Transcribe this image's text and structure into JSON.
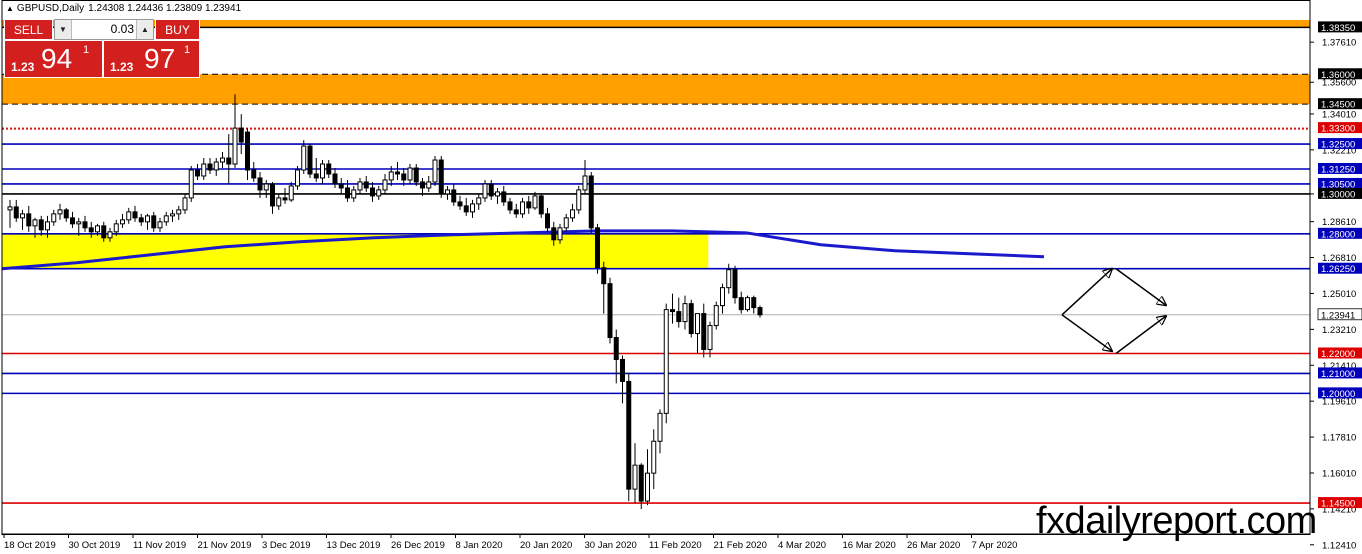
{
  "header": {
    "symbol": "GBPUSD,Daily",
    "ohlc": "1.24308 1.24436 1.23809 1.23941"
  },
  "trade_panel": {
    "sell_label": "SELL",
    "buy_label": "BUY",
    "lot_value": "0.03",
    "sell_price": {
      "prefix": "1.23",
      "big": "94",
      "pip": "1"
    },
    "buy_price": {
      "prefix": "1.23",
      "big": "97",
      "pip": "1"
    }
  },
  "watermark": "fxdailyreport.com",
  "colors": {
    "bull": "#ffffff",
    "bear": "#000000",
    "ma": "#1a1acc",
    "zone_orange": "#ffa000",
    "zone_yellow": "#ffff00",
    "support_red": "#dd0000",
    "level_blue": "#0000bb",
    "level_black": "#000000",
    "panel_red": "#d41f1f"
  },
  "chart_data": {
    "type": "candlestick",
    "symbol": "GBPUSD",
    "timeframe": "Daily",
    "ylim": [
      1.1295,
      1.3872
    ],
    "yticks": [
      "1.37610",
      "1.35600",
      "1.34010",
      "1.32210",
      "1.30000",
      "1.28610",
      "1.26810",
      "1.25010",
      "1.23210",
      "1.21410",
      "1.19610",
      "1.17810",
      "1.16010",
      "1.14210",
      "1.12410"
    ],
    "xticks": [
      "18 Oct 2019",
      "30 Oct 2019",
      "11 Nov 2019",
      "21 Nov 2019",
      "3 Dec 2019",
      "13 Dec 2019",
      "26 Dec 2019",
      "8 Jan 2020",
      "20 Jan 2020",
      "30 Jan 2020",
      "11 Feb 2020",
      "21 Feb 2020",
      "4 Mar 2020",
      "16 Mar 2020",
      "26 Mar 2020",
      "7 Apr 2020"
    ],
    "current_price": "1.23941",
    "levels": [
      {
        "price": 1.3835,
        "label": "1.38350",
        "color": "#000000",
        "style": "solid"
      },
      {
        "price": 1.36,
        "label": "1.36000",
        "color": "#000000",
        "style": "dashed"
      },
      {
        "price": 1.345,
        "label": "1.34500",
        "color": "#000000",
        "style": "dashed"
      },
      {
        "price": 1.333,
        "label": "1.33300",
        "color": "#dd0000",
        "style": "dotted"
      },
      {
        "price": 1.3325,
        "label": "",
        "color": "#dd0000",
        "style": "dotted"
      },
      {
        "price": 1.325,
        "label": "1.32500",
        "color": "#0000bb",
        "style": "solid"
      },
      {
        "price": 1.3125,
        "label": "1.31250",
        "color": "#0000bb",
        "style": "solid"
      },
      {
        "price": 1.305,
        "label": "1.30500",
        "color": "#0000bb",
        "style": "solid"
      },
      {
        "price": 1.3,
        "label": "1.30000",
        "color": "#000000",
        "style": "solid"
      },
      {
        "price": 1.28,
        "label": "1.28000",
        "color": "#0000bb",
        "style": "solid"
      },
      {
        "price": 1.2625,
        "label": "1.26250",
        "color": "#0000bb",
        "style": "solid"
      },
      {
        "price": 1.22,
        "label": "1.22000",
        "color": "#dd0000",
        "style": "solid"
      },
      {
        "price": 1.21,
        "label": "1.21000",
        "color": "#0000bb",
        "style": "solid"
      },
      {
        "price": 1.2,
        "label": "1.20000",
        "color": "#0000bb",
        "style": "solid"
      },
      {
        "price": 1.145,
        "label": "1.14500",
        "color": "#dd0000",
        "style": "solid"
      }
    ],
    "zones": [
      {
        "color": "#ffa000",
        "from": 1.3835,
        "to": 1.3872,
        "x_start": 0,
        "x_end": 1
      },
      {
        "color": "#ffa000",
        "from": 1.345,
        "to": 1.36,
        "x_start": 0,
        "x_end": 1
      },
      {
        "color": "#ffff00",
        "from": 1.2625,
        "to": 1.28,
        "x_start": 0,
        "x_end": 0.54
      }
    ],
    "moving_average": [
      1.2625,
      1.2655,
      1.2695,
      1.2735,
      1.276,
      1.278,
      1.2795,
      1.2805,
      1.2815,
      1.2815,
      1.2805,
      1.2745,
      1.2715,
      1.27,
      1.2685
    ],
    "ohlc": [
      [
        1.292,
        1.297,
        1.283,
        1.2935
      ],
      [
        1.2935,
        1.297,
        1.286,
        1.288
      ],
      [
        1.288,
        1.292,
        1.282,
        1.29
      ],
      [
        1.29,
        1.294,
        1.281,
        1.284
      ],
      [
        1.284,
        1.288,
        1.278,
        1.287
      ],
      [
        1.287,
        1.289,
        1.279,
        1.282
      ],
      [
        1.282,
        1.289,
        1.278,
        1.286
      ],
      [
        1.286,
        1.292,
        1.284,
        1.29
      ],
      [
        1.29,
        1.295,
        1.287,
        1.292
      ],
      [
        1.292,
        1.293,
        1.286,
        1.288
      ],
      [
        1.288,
        1.291,
        1.283,
        1.285
      ],
      [
        1.285,
        1.288,
        1.279,
        1.286
      ],
      [
        1.286,
        1.289,
        1.281,
        1.283
      ],
      [
        1.283,
        1.286,
        1.278,
        1.281
      ],
      [
        1.281,
        1.285,
        1.279,
        1.284
      ],
      [
        1.284,
        1.286,
        1.276,
        1.278
      ],
      [
        1.278,
        1.283,
        1.276,
        1.281
      ],
      [
        1.281,
        1.287,
        1.279,
        1.285
      ],
      [
        1.285,
        1.29,
        1.283,
        1.287
      ],
      [
        1.287,
        1.293,
        1.285,
        1.291
      ],
      [
        1.291,
        1.294,
        1.286,
        1.288
      ],
      [
        1.288,
        1.29,
        1.284,
        1.286
      ],
      [
        1.286,
        1.29,
        1.282,
        1.289
      ],
      [
        1.289,
        1.291,
        1.281,
        1.283
      ],
      [
        1.283,
        1.288,
        1.281,
        1.286
      ],
      [
        1.286,
        1.291,
        1.284,
        1.289
      ],
      [
        1.289,
        1.292,
        1.286,
        1.29
      ],
      [
        1.29,
        1.294,
        1.287,
        1.292
      ],
      [
        1.292,
        1.3,
        1.29,
        1.298
      ],
      [
        1.298,
        1.314,
        1.296,
        1.312
      ],
      [
        1.312,
        1.315,
        1.307,
        1.309
      ],
      [
        1.309,
        1.318,
        1.307,
        1.315
      ],
      [
        1.315,
        1.318,
        1.31,
        1.312
      ],
      [
        1.312,
        1.318,
        1.309,
        1.316
      ],
      [
        1.316,
        1.321,
        1.313,
        1.318
      ],
      [
        1.318,
        1.33,
        1.305,
        1.315
      ],
      [
        1.315,
        1.35,
        1.313,
        1.333
      ],
      [
        1.333,
        1.34,
        1.32,
        1.326
      ],
      [
        1.331,
        1.333,
        1.307,
        1.312
      ],
      [
        1.312,
        1.316,
        1.306,
        1.308
      ],
      [
        1.308,
        1.311,
        1.298,
        1.302
      ],
      [
        1.302,
        1.307,
        1.298,
        1.305
      ],
      [
        1.305,
        1.306,
        1.29,
        1.294
      ],
      [
        1.294,
        1.3,
        1.292,
        1.298
      ],
      [
        1.298,
        1.303,
        1.295,
        1.297
      ],
      [
        1.297,
        1.306,
        1.296,
        1.304
      ],
      [
        1.304,
        1.314,
        1.302,
        1.312
      ],
      [
        1.312,
        1.327,
        1.31,
        1.324
      ],
      [
        1.324,
        1.325,
        1.308,
        1.31
      ],
      [
        1.31,
        1.318,
        1.306,
        1.308
      ],
      [
        1.308,
        1.317,
        1.305,
        1.315
      ],
      [
        1.315,
        1.317,
        1.308,
        1.31
      ],
      [
        1.31,
        1.313,
        1.303,
        1.305
      ],
      [
        1.305,
        1.308,
        1.3,
        1.303
      ],
      [
        1.303,
        1.307,
        1.296,
        1.298
      ],
      [
        1.298,
        1.304,
        1.296,
        1.302
      ],
      [
        1.302,
        1.308,
        1.3,
        1.306
      ],
      [
        1.306,
        1.309,
        1.301,
        1.303
      ],
      [
        1.303,
        1.306,
        1.296,
        1.299
      ],
      [
        1.299,
        1.304,
        1.297,
        1.302
      ],
      [
        1.302,
        1.31,
        1.3,
        1.307
      ],
      [
        1.307,
        1.314,
        1.304,
        1.311
      ],
      [
        1.311,
        1.316,
        1.307,
        1.31
      ],
      [
        1.31,
        1.313,
        1.304,
        1.307
      ],
      [
        1.307,
        1.315,
        1.305,
        1.313
      ],
      [
        1.313,
        1.315,
        1.304,
        1.306
      ],
      [
        1.306,
        1.308,
        1.299,
        1.303
      ],
      [
        1.303,
        1.309,
        1.301,
        1.306
      ],
      [
        1.306,
        1.319,
        1.304,
        1.317
      ],
      [
        1.317,
        1.319,
        1.298,
        1.3
      ],
      [
        1.3,
        1.304,
        1.297,
        1.302
      ],
      [
        1.302,
        1.305,
        1.294,
        1.296
      ],
      [
        1.296,
        1.299,
        1.292,
        1.294
      ],
      [
        1.294,
        1.298,
        1.289,
        1.291
      ],
      [
        1.291,
        1.297,
        1.288,
        1.295
      ],
      [
        1.295,
        1.3,
        1.292,
        1.298
      ],
      [
        1.298,
        1.307,
        1.296,
        1.305
      ],
      [
        1.305,
        1.307,
        1.297,
        1.299
      ],
      [
        1.299,
        1.303,
        1.295,
        1.301
      ],
      [
        1.301,
        1.304,
        1.294,
        1.296
      ],
      [
        1.296,
        1.298,
        1.29,
        1.292
      ],
      [
        1.292,
        1.295,
        1.288,
        1.29
      ],
      [
        1.29,
        1.298,
        1.288,
        1.296
      ],
      [
        1.296,
        1.299,
        1.29,
        1.293
      ],
      [
        1.293,
        1.301,
        1.292,
        1.299
      ],
      [
        1.299,
        1.3,
        1.288,
        1.29
      ],
      [
        1.29,
        1.293,
        1.281,
        1.283
      ],
      [
        1.283,
        1.286,
        1.274,
        1.277
      ],
      [
        1.277,
        1.285,
        1.275,
        1.283
      ],
      [
        1.283,
        1.29,
        1.281,
        1.288
      ],
      [
        1.288,
        1.295,
        1.286,
        1.292
      ],
      [
        1.292,
        1.304,
        1.29,
        1.302
      ],
      [
        1.302,
        1.317,
        1.3,
        1.309
      ],
      [
        1.309,
        1.311,
        1.28,
        1.283
      ],
      [
        1.283,
        1.285,
        1.26,
        1.263
      ],
      [
        1.263,
        1.266,
        1.24,
        1.255
      ],
      [
        1.255,
        1.258,
        1.225,
        1.228
      ],
      [
        1.228,
        1.232,
        1.205,
        1.217
      ],
      [
        1.217,
        1.219,
        1.195,
        1.206
      ],
      [
        1.206,
        1.21,
        1.146,
        1.152
      ],
      [
        1.152,
        1.175,
        1.145,
        1.164
      ],
      [
        1.164,
        1.165,
        1.142,
        1.146
      ],
      [
        1.146,
        1.172,
        1.144,
        1.16
      ],
      [
        1.16,
        1.182,
        1.152,
        1.176
      ],
      [
        1.176,
        1.192,
        1.17,
        1.19
      ],
      [
        1.19,
        1.245,
        1.185,
        1.242
      ],
      [
        1.242,
        1.25,
        1.235,
        1.241
      ],
      [
        1.241,
        1.248,
        1.233,
        1.236
      ],
      [
        1.236,
        1.249,
        1.232,
        1.245
      ],
      [
        1.245,
        1.247,
        1.228,
        1.23
      ],
      [
        1.23,
        1.24,
        1.22,
        1.24
      ],
      [
        1.24,
        1.245,
        1.218,
        1.222
      ],
      [
        1.222,
        1.236,
        1.218,
        1.234
      ],
      [
        1.234,
        1.246,
        1.232,
        1.244
      ],
      [
        1.244,
        1.255,
        1.24,
        1.253
      ],
      [
        1.253,
        1.265,
        1.25,
        1.262
      ],
      [
        1.262,
        1.264,
        1.245,
        1.248
      ],
      [
        1.248,
        1.251,
        1.24,
        1.242
      ],
      [
        1.242,
        1.249,
        1.241,
        1.248
      ],
      [
        1.248,
        1.249,
        1.24,
        1.243
      ],
      [
        1.243,
        1.244,
        1.238,
        1.2394
      ]
    ],
    "annotation": "projection arrows: from 1.2394 rising to 1.2625 then down to 1.2400, or falling to 1.2200 then up to 1.2400"
  }
}
